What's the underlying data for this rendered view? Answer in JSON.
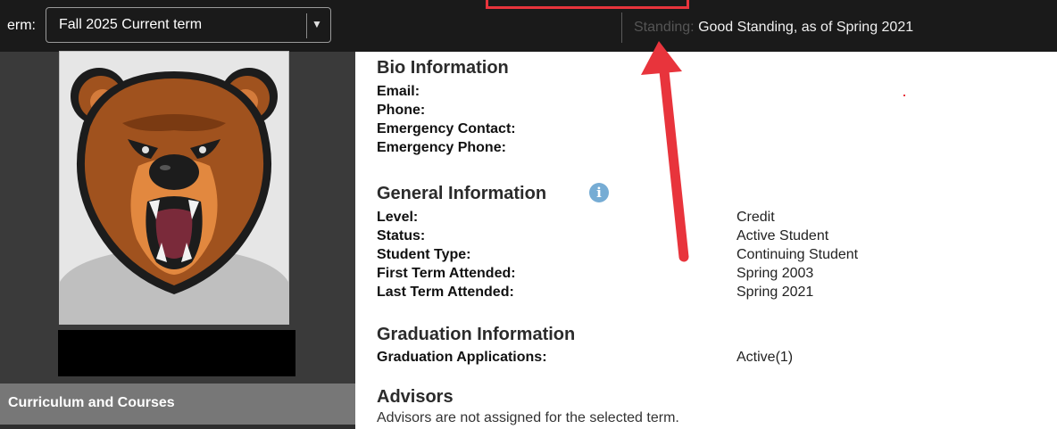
{
  "header": {
    "term_label": "erm:",
    "term_select": {
      "value": "Fall 2025 Current term"
    },
    "standing": {
      "label": "Standing:",
      "value": "Good Standing, as of Spring 2021"
    }
  },
  "sidebar": {
    "curriculum_tab_label": "Curriculum and Courses"
  },
  "bio": {
    "title": "Bio Information",
    "fields": [
      {
        "label": "Email:"
      },
      {
        "label": "Phone:"
      },
      {
        "label": "Emergency Contact:"
      },
      {
        "label": "Emergency Phone:"
      }
    ]
  },
  "general": {
    "title": "General Information",
    "info_icon_glyph": "i",
    "fields": [
      {
        "label": "Level:",
        "value": "Credit"
      },
      {
        "label": "Status:",
        "value": "Active Student"
      },
      {
        "label": "Student Type:",
        "value": "Continuing Student"
      },
      {
        "label": "First Term Attended:",
        "value": "Spring 2003"
      },
      {
        "label": "Last Term Attended:",
        "value": "Spring 2021"
      }
    ]
  },
  "graduation": {
    "title": "Graduation Information",
    "fields": [
      {
        "label": "Graduation Applications:",
        "value": "Active(1)"
      }
    ]
  },
  "advisors": {
    "title": "Advisors",
    "message": "Advisors are not assigned for the selected term."
  },
  "colors": {
    "top_bar": "#1a1a1a",
    "sidebar": "#3a3a3a",
    "annotation_red": "#e8343c",
    "info_blue": "#76acd4"
  },
  "icons": {
    "avatar": "bear-mascot-avatar",
    "info": "info-icon",
    "dropdown": "chevron-down-icon",
    "annotation": "red-arrow-annotation"
  }
}
